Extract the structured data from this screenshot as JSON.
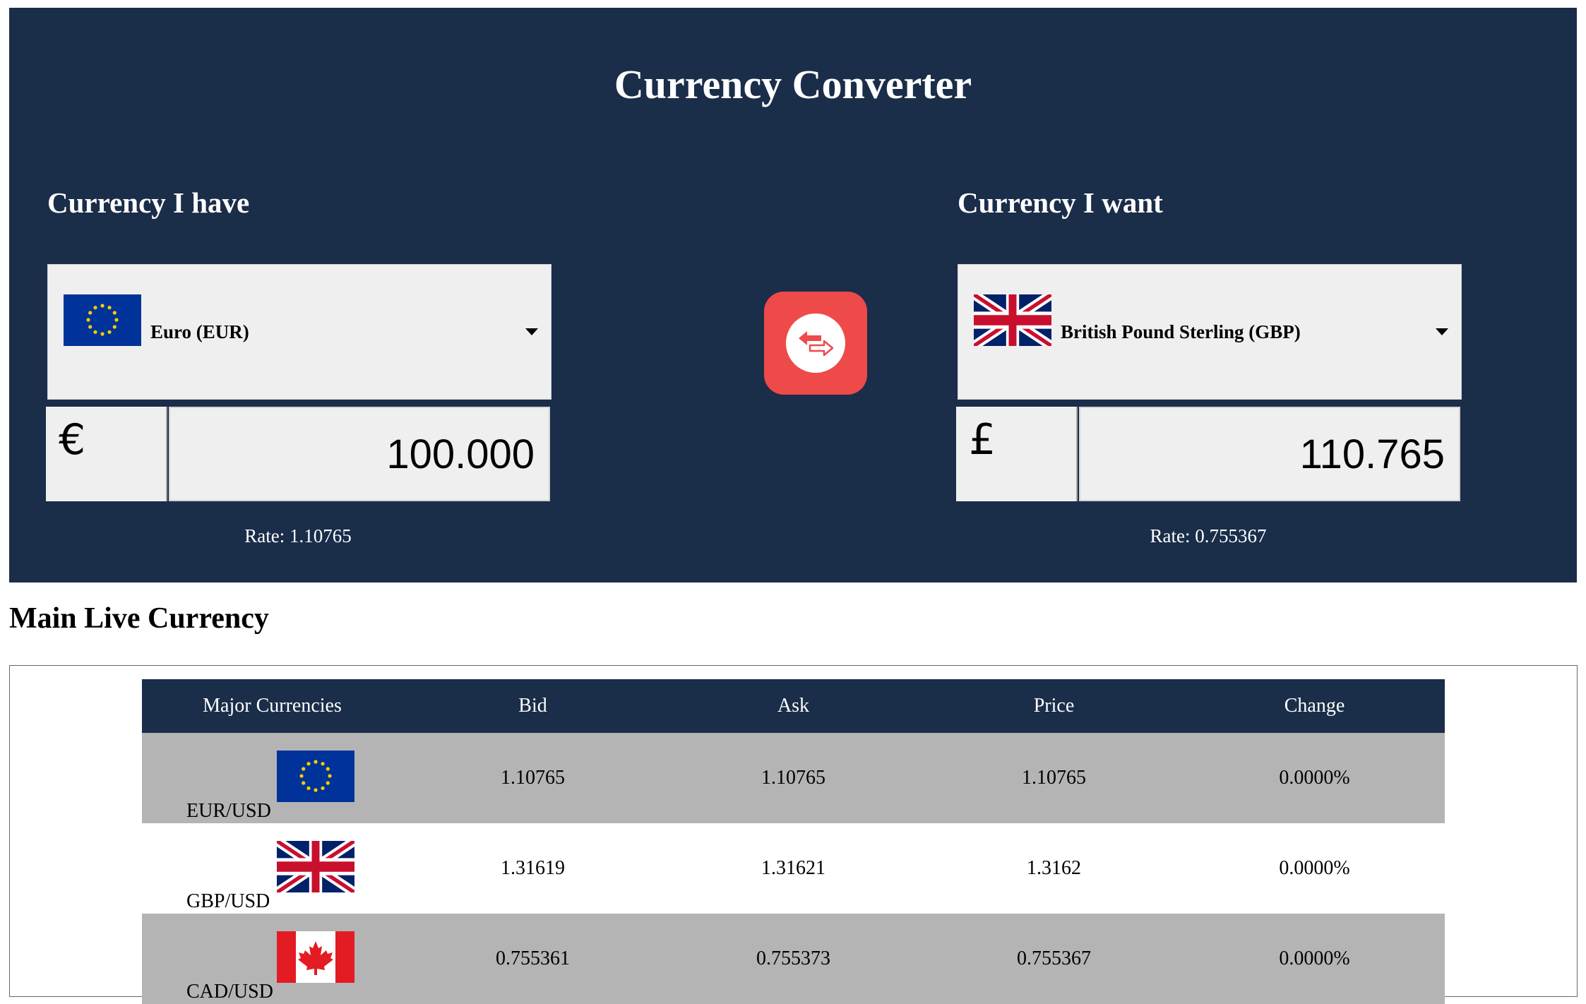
{
  "app": {
    "title": "Currency Converter"
  },
  "from": {
    "label": "Currency I have",
    "selected": "Euro (EUR)",
    "symbol": "€",
    "amount": "100.000",
    "rate": "Rate: 1.10765",
    "flag_icon": "eu-flag-icon"
  },
  "to": {
    "label": "Currency I want",
    "selected": "British Pound Sterling (GBP)",
    "symbol": "£",
    "amount": "110.765",
    "rate": "Rate: 0.755367",
    "flag_icon": "uk-flag-icon"
  },
  "swap": {
    "icon": "swap-arrows-icon"
  },
  "live": {
    "heading": "Main Live Currency",
    "columns": [
      "Major Currencies",
      "Bid",
      "Ask",
      "Price",
      "Change"
    ],
    "rows": [
      {
        "pair": "EUR/USD",
        "flag": "eu-flag-icon",
        "bid": "1.10765",
        "ask": "1.10765",
        "price": "1.10765",
        "change": "0.0000%"
      },
      {
        "pair": "GBP/USD",
        "flag": "uk-flag-icon",
        "bid": "1.31619",
        "ask": "1.31621",
        "price": "1.3162",
        "change": "0.0000%"
      },
      {
        "pair": "CAD/USD",
        "flag": "canada-flag-icon",
        "bid": "0.755361",
        "ask": "0.755373",
        "price": "0.755367",
        "change": "0.0000%"
      }
    ]
  },
  "colors": {
    "header_bg": "#1a2d49",
    "swap_button": "#ee4a4a",
    "row_shaded": "#b4b4b4",
    "input_bg": "#efefef"
  }
}
